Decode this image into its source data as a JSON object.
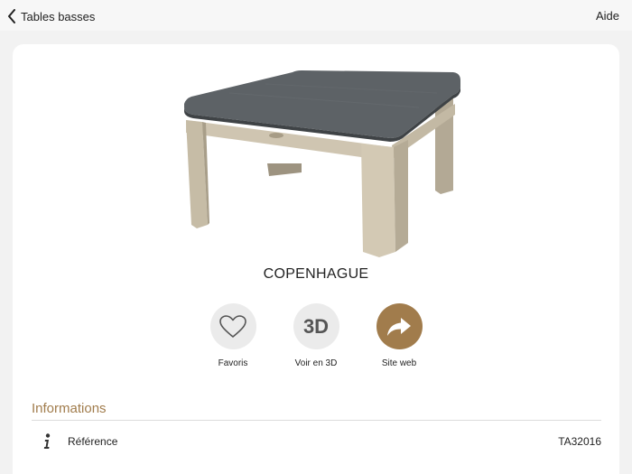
{
  "nav": {
    "back_label": "Tables basses",
    "help_label": "Aide"
  },
  "product": {
    "name": "COPENHAGUE",
    "image_alt": "table-basse-plateau-gris-pieds-bois"
  },
  "actions": [
    {
      "label": "Favoris",
      "icon": "heart-icon"
    },
    {
      "label": "Voir en 3D",
      "icon_text": "3D"
    },
    {
      "label": "Site web",
      "icon": "share-arrow-icon"
    }
  ],
  "info": {
    "title": "Informations",
    "rows": [
      {
        "label": "Référence",
        "value": "TA32016",
        "icon": "info-icon"
      }
    ]
  },
  "colors": {
    "accent": "#a17c4c",
    "circle_bg": "#ebebeb",
    "page_bg": "#f2f2f2"
  }
}
